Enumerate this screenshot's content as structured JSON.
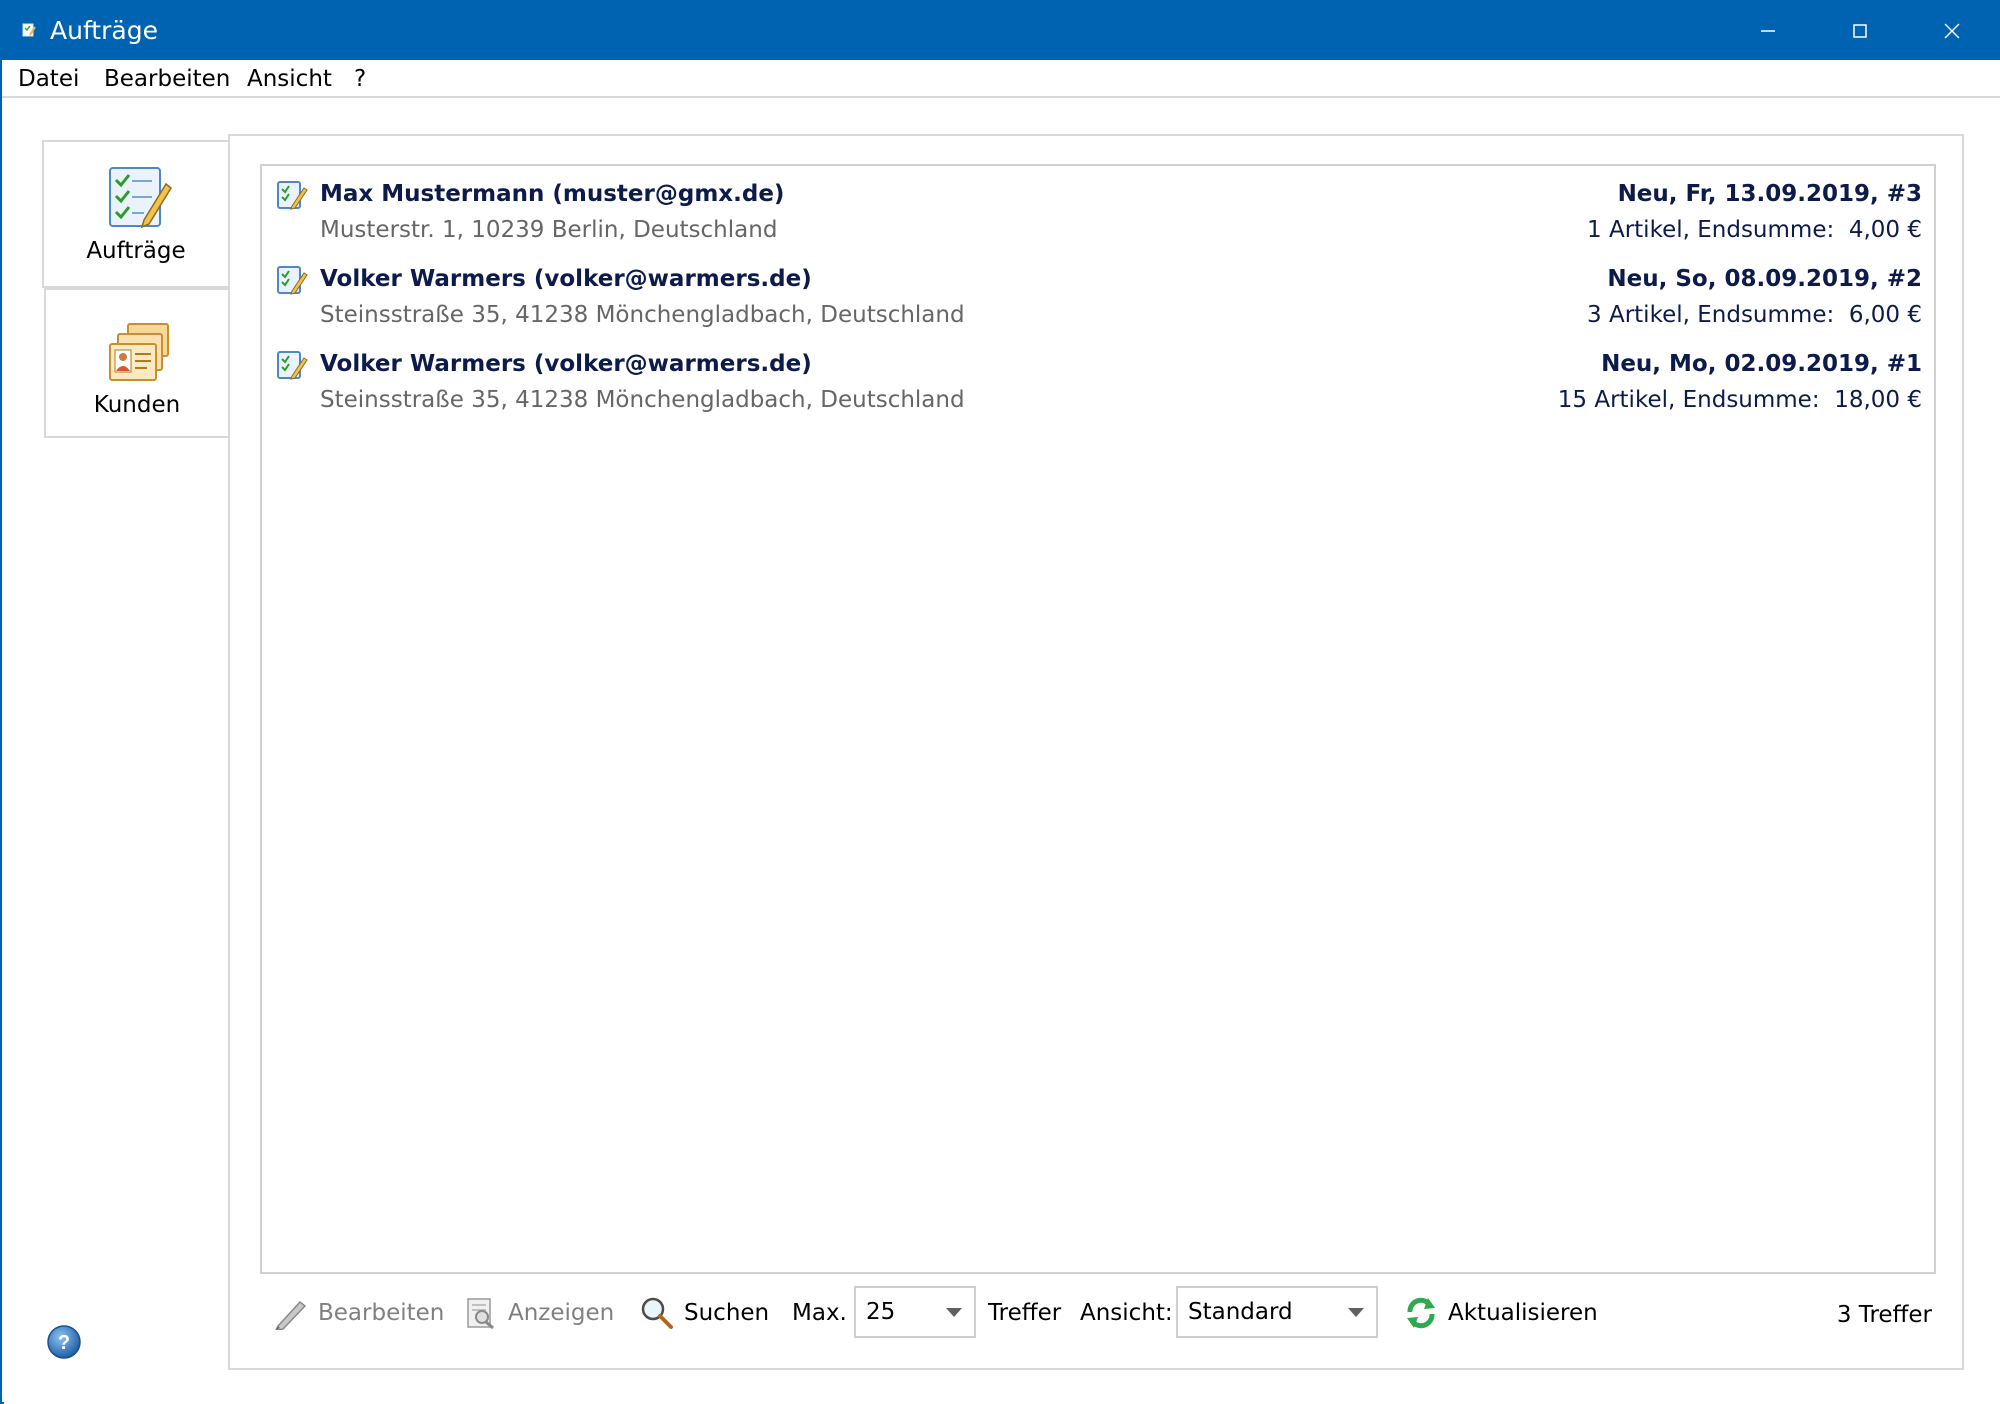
{
  "window": {
    "title": "Aufträge",
    "title_bar_color": "#0063b1",
    "controls": [
      "minimize-icon",
      "maximize-icon",
      "close-icon"
    ]
  },
  "menu": {
    "items": [
      "Datei",
      "Bearbeiten",
      "Ansicht",
      "?"
    ]
  },
  "sidebar": {
    "tabs": [
      {
        "label": "Aufträge",
        "icon": "checklist-pencil-icon",
        "active": true
      },
      {
        "label": "Kunden",
        "icon": "contact-cards-icon",
        "active": false
      }
    ],
    "help_icon": "help-icon"
  },
  "orders": [
    {
      "customer": "Max Mustermann (muster@gmx.de)",
      "address": "Musterstr. 1, 10239 Berlin, Deutschland",
      "status": "Neu, Fr, 13.09.2019, #3",
      "summary": "1 Artikel, Endsumme:  4,00 €",
      "icon": "order-icon"
    },
    {
      "customer": "Volker Warmers (volker@warmers.de)",
      "address": "Steinsstraße 35, 41238 Mönchengladbach, Deutschland",
      "status": "Neu, So, 08.09.2019, #2",
      "summary": "3 Artikel, Endsumme:  6,00 €",
      "icon": "order-icon"
    },
    {
      "customer": "Volker Warmers (volker@warmers.de)",
      "address": "Steinsstraße 35, 41238 Mönchengladbach, Deutschland",
      "status": "Neu, Mo, 02.09.2019, #1",
      "summary": "15 Artikel, Endsumme:  18,00 €",
      "icon": "order-icon"
    }
  ],
  "toolbar": {
    "edit_label": "Bearbeiten",
    "edit_enabled": false,
    "show_label": "Anzeigen",
    "show_enabled": false,
    "search_label": "Suchen",
    "max_label": "Max.",
    "max_value": "25",
    "hits_label": "Treffer",
    "view_label": "Ansicht:",
    "view_value": "Standard",
    "refresh_label": "Aktualisieren",
    "hit_count": "3 Treffer"
  }
}
